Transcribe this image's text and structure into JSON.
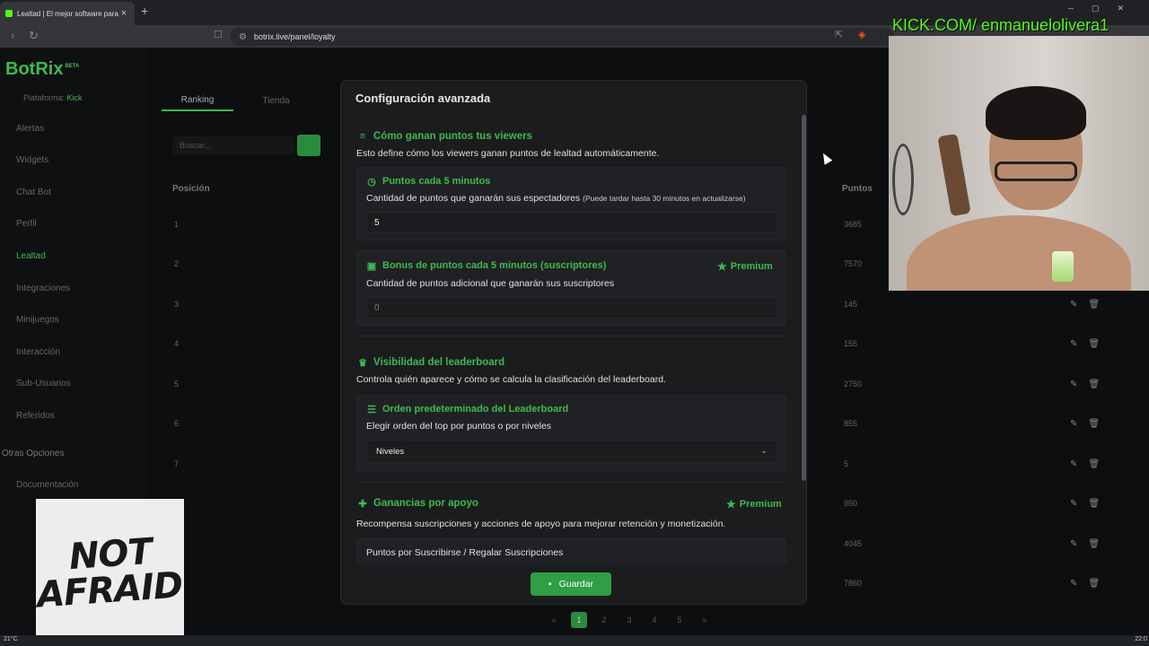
{
  "browser": {
    "tab_title": "Lealtad | El mejor software para",
    "tab_close": "×",
    "new_tab": "+",
    "url": "botrix.live/panel/loyalty"
  },
  "app": {
    "logo": "BotRix",
    "logo_badge": "BETA",
    "platform_label": "Plataforma:",
    "platform_value": "Kick",
    "sidebar_items": [
      {
        "label": "Alertas"
      },
      {
        "label": "Widgets"
      },
      {
        "label": "Chat Bot"
      },
      {
        "label": "Perfil"
      },
      {
        "label": "Lealtad"
      },
      {
        "label": "Integraciones"
      },
      {
        "label": "Minijuegos"
      },
      {
        "label": "Interacción"
      },
      {
        "label": "Sub-Usuarios"
      },
      {
        "label": "Referidos"
      }
    ],
    "other_options_heading": "Otras Opciones",
    "sidebar_extra": [
      {
        "label": "Documentación"
      }
    ],
    "tabs": [
      {
        "label": "Ranking"
      },
      {
        "label": "Tienda"
      }
    ],
    "search_placeholder": "Buscar...",
    "col_position": "Posición",
    "col_points": "Puntos",
    "rows": [
      {
        "pos": "1",
        "points": "3685"
      },
      {
        "pos": "2",
        "points": "7570"
      },
      {
        "pos": "3",
        "points": "145"
      },
      {
        "pos": "4",
        "points": "155"
      },
      {
        "pos": "5",
        "points": "2750"
      },
      {
        "pos": "6",
        "points": "855"
      },
      {
        "pos": "7",
        "points": "5"
      },
      {
        "pos": "",
        "points": "950"
      },
      {
        "pos": "",
        "points": "4045"
      },
      {
        "pos": "",
        "points": "7860"
      }
    ],
    "pages": [
      "1",
      "2",
      "3",
      "4",
      "5"
    ]
  },
  "modal": {
    "title": "Configuración avanzada",
    "section_earn": {
      "title": "Cómo ganan puntos tus viewers",
      "description": "Esto define cómo los viewers ganan puntos de lealtad automáticamente."
    },
    "card_points": {
      "title": "Puntos cada 5 minutos",
      "description": "Cantidad de puntos que ganarán sus espectadores",
      "note": "(Puede tardar hasta 30 minutos en actualizarse)",
      "value": "5"
    },
    "card_bonus": {
      "title": "Bonus de puntos cada 5 minutos (suscriptores)",
      "premium": "Premium",
      "description": "Cantidad de puntos adicional que ganarán sus suscriptores",
      "value": "0"
    },
    "section_visibility": {
      "title": "Visibilidad del leaderboard",
      "description": "Controla quién aparece y cómo se calcula la clasificación del leaderboard."
    },
    "card_order": {
      "title": "Orden predeterminado del Leaderboard",
      "description": "Elegir orden del top por puntos o por niveles",
      "selected": "Niveles"
    },
    "section_support": {
      "title": "Ganancias por apoyo",
      "premium": "Premium",
      "description": "Recompensa suscripciones y acciones de apoyo para mejorar retención y monetización."
    },
    "card_subscribe": {
      "title": "Puntos por Suscribirse / Regalar Suscripciones"
    },
    "save_label": "Guardar"
  },
  "overlays": {
    "kick_text": "KICK.COM/ enmanuelolivera1",
    "not_afraid_line1": "NOT",
    "not_afraid_line2": "AFRAID"
  },
  "taskbar": {
    "temperature": "21°C",
    "clock": "22:0"
  },
  "colors": {
    "accent_green": "#3fb950",
    "save_button": "#2f9e44",
    "kick_green": "#53fc18",
    "modal_bg": "#1b1c1e"
  }
}
